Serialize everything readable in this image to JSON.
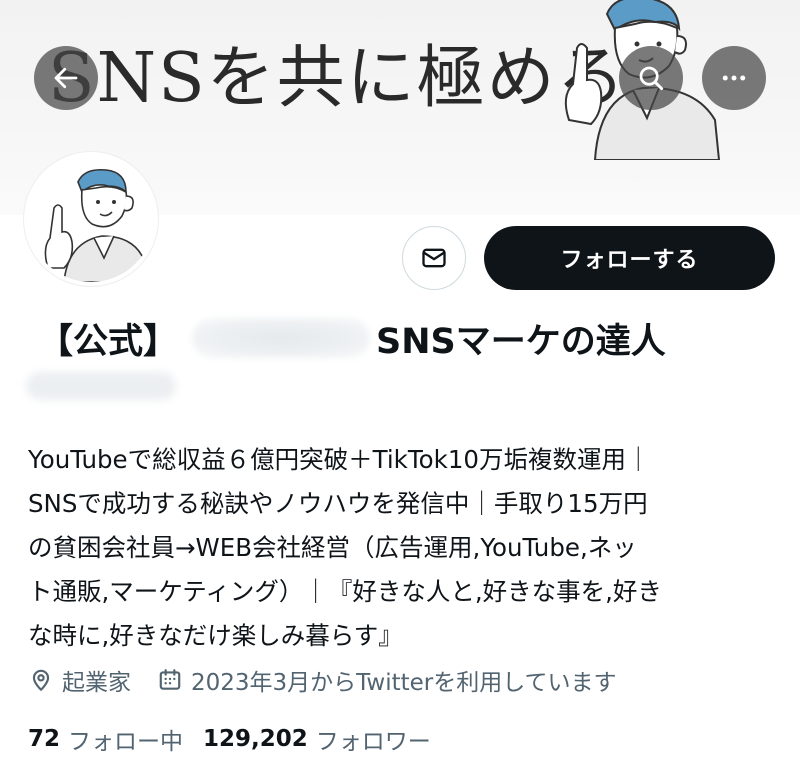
{
  "banner": {
    "title": "SNSを共に極める"
  },
  "header_buttons": {
    "back_icon": "arrow-left-icon",
    "search_icon": "search-icon",
    "more_icon": "ellipsis-icon"
  },
  "profile": {
    "name_prefix": "【公式】",
    "name_suffix": "SNSマーケの達人",
    "bio_lines": [
      "YouTubeで総収益６億円突破＋TikTok10万垢複数運用｜",
      "SNSで成功する秘訣やノウハウを発信中｜手取り15万円",
      "の貧困会社員→WEB会社経営（広告運用,YouTube,ネッ",
      "ト通販,マーケティング）｜『好きな人と,好きな事を,好き",
      "な時に,好きなだけ楽しみ暮らす』"
    ],
    "location": "起業家",
    "joined": "2023年3月からTwitterを利用しています"
  },
  "actions": {
    "mail_icon": "envelope-icon",
    "follow_label": "フォローする"
  },
  "stats": {
    "following_count": "72",
    "following_label": "フォロー中",
    "followers_count": "129,202",
    "followers_label": "フォロワー"
  },
  "colors": {
    "primary_text": "#0f1419",
    "secondary_text": "#536471",
    "follow_button_bg": "#0f1419",
    "illustration_hair": "#5b9bc8"
  }
}
